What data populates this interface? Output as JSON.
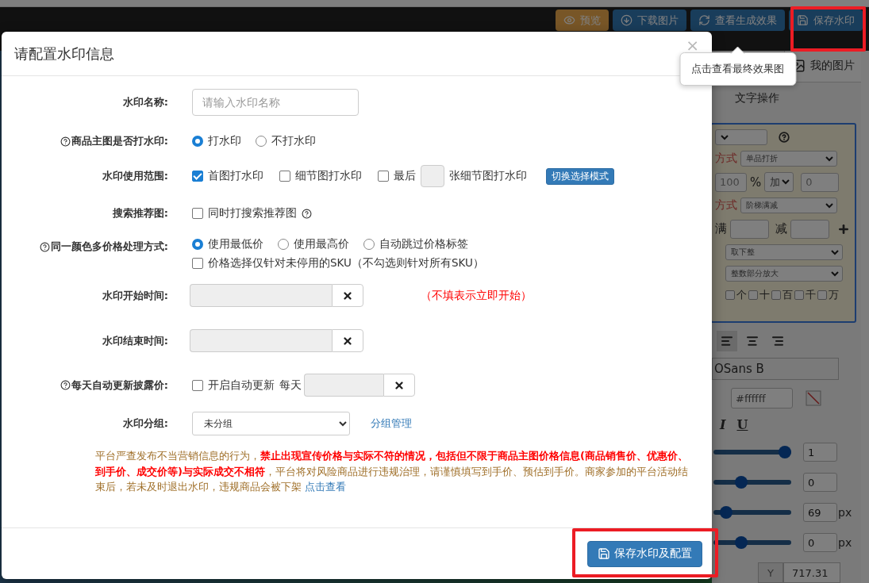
{
  "toolbar": {
    "buttons": [
      {
        "label": "预览",
        "kind": "warning",
        "highlighted": false
      },
      {
        "label": "下载图片",
        "kind": "primary",
        "highlighted": false
      },
      {
        "label": "查看生成效果",
        "kind": "primary",
        "highlighted": false,
        "tooltip": "点击查看最终效果图"
      },
      {
        "label": "保存水印",
        "kind": "primary",
        "highlighted": true
      }
    ]
  },
  "side_panel": {
    "tab": "我的图片",
    "section_title": "文字操作",
    "price_box": {
      "discount_label": "方式",
      "discount_select": "单品打折",
      "percent_input": "100",
      "percent_sign": "%",
      "operator_select": "加",
      "offset_input": "0",
      "promo_label": "方式",
      "promo_select": "阶梯满减",
      "full_label": "满",
      "minus_label": "减",
      "rounding_select": "取下整",
      "emphasis_select": "整数部分放大",
      "digits": [
        {
          "label": "个",
          "checked": false
        },
        {
          "label": "十",
          "checked": false
        },
        {
          "label": "百",
          "checked": false
        },
        {
          "label": "千",
          "checked": false
        },
        {
          "label": "万",
          "checked": false
        }
      ]
    },
    "align_buttons": [
      {
        "kind": "left",
        "selected": true
      },
      {
        "kind": "center",
        "selected": false
      },
      {
        "kind": "right",
        "selected": false
      }
    ],
    "font_value": "OSans B",
    "color_value": "#ffffff",
    "style_buttons": [
      {
        "label": "I",
        "kind": "italic"
      },
      {
        "label": "U",
        "kind": "underline"
      }
    ],
    "sliders": [
      {
        "level": 1,
        "value": "1"
      },
      {
        "level": 0.33,
        "value": "0"
      },
      {
        "level": 0.1,
        "value": "69",
        "unit": "px"
      },
      {
        "level": 0.33,
        "value": "0",
        "unit": "px"
      }
    ],
    "position": {
      "y_label": "Y",
      "y_value": "717.31"
    }
  },
  "dialog": {
    "title": "请配置水印信息",
    "close": "×",
    "fields": [
      {
        "kind": "text",
        "label": "水印名称:",
        "placeholder": "请输入水印名称"
      },
      {
        "kind": "radio",
        "label": "商品主图是否打水印:",
        "help": true,
        "options": [
          {
            "label": "打水印",
            "selected": true
          },
          {
            "label": "不打水印",
            "selected": false
          }
        ]
      },
      {
        "kind": "scope",
        "label": "水印使用范围:",
        "options": [
          {
            "label": "首图打水印",
            "checked": true
          },
          {
            "label": "细节图打水印",
            "checked": false
          },
          {
            "label": "最后",
            "checked": false,
            "suffix": "张细节图打水印"
          }
        ],
        "button": "切换选择模式"
      },
      {
        "kind": "checkbox",
        "label": "搜索推荐图:",
        "options": [
          {
            "label": "同时打搜索推荐图",
            "checked": false,
            "help": true
          }
        ]
      },
      {
        "kind": "radio",
        "label": "同一颜色多价格处理方式:",
        "help": true,
        "options": [
          {
            "label": "使用最低价",
            "selected": true
          },
          {
            "label": "使用最高价",
            "selected": false
          },
          {
            "label": "自动跳过价格标签",
            "selected": false
          }
        ],
        "extra": {
          "label": "价格选择仅针对未停用的SKU（不勾选则针对所有SKU）",
          "checked": false
        }
      },
      {
        "kind": "time",
        "label": "水印开始时间:",
        "note": "（不填表示立即开始）"
      },
      {
        "kind": "time",
        "label": "水印结束时间:"
      },
      {
        "kind": "daily",
        "label": "每天自动更新披露价:",
        "help": true,
        "checkbox": {
          "label": "开启自动更新",
          "checked": false
        },
        "between": "每天"
      },
      {
        "kind": "select",
        "label": "水印分组:",
        "value": "未分组",
        "link": "分组管理"
      }
    ],
    "notice": {
      "text": "平台严查发布不当营销信息的行为，**禁止出现宣传价格与实际不符的情况，包括但不限于商品主图价格信息(商品销售价、优惠价、到手价、成交价等)与实际成交不相符**，平台将对风险商品进行违规治理，请谨慎填写到手价、预估到手价。商家参加的平台活动结束后，若未及时退出水印，违规商品会被下架",
      "link": "点击查看"
    },
    "save_button": {
      "label": "保存水印及配置",
      "highlighted": true
    }
  }
}
